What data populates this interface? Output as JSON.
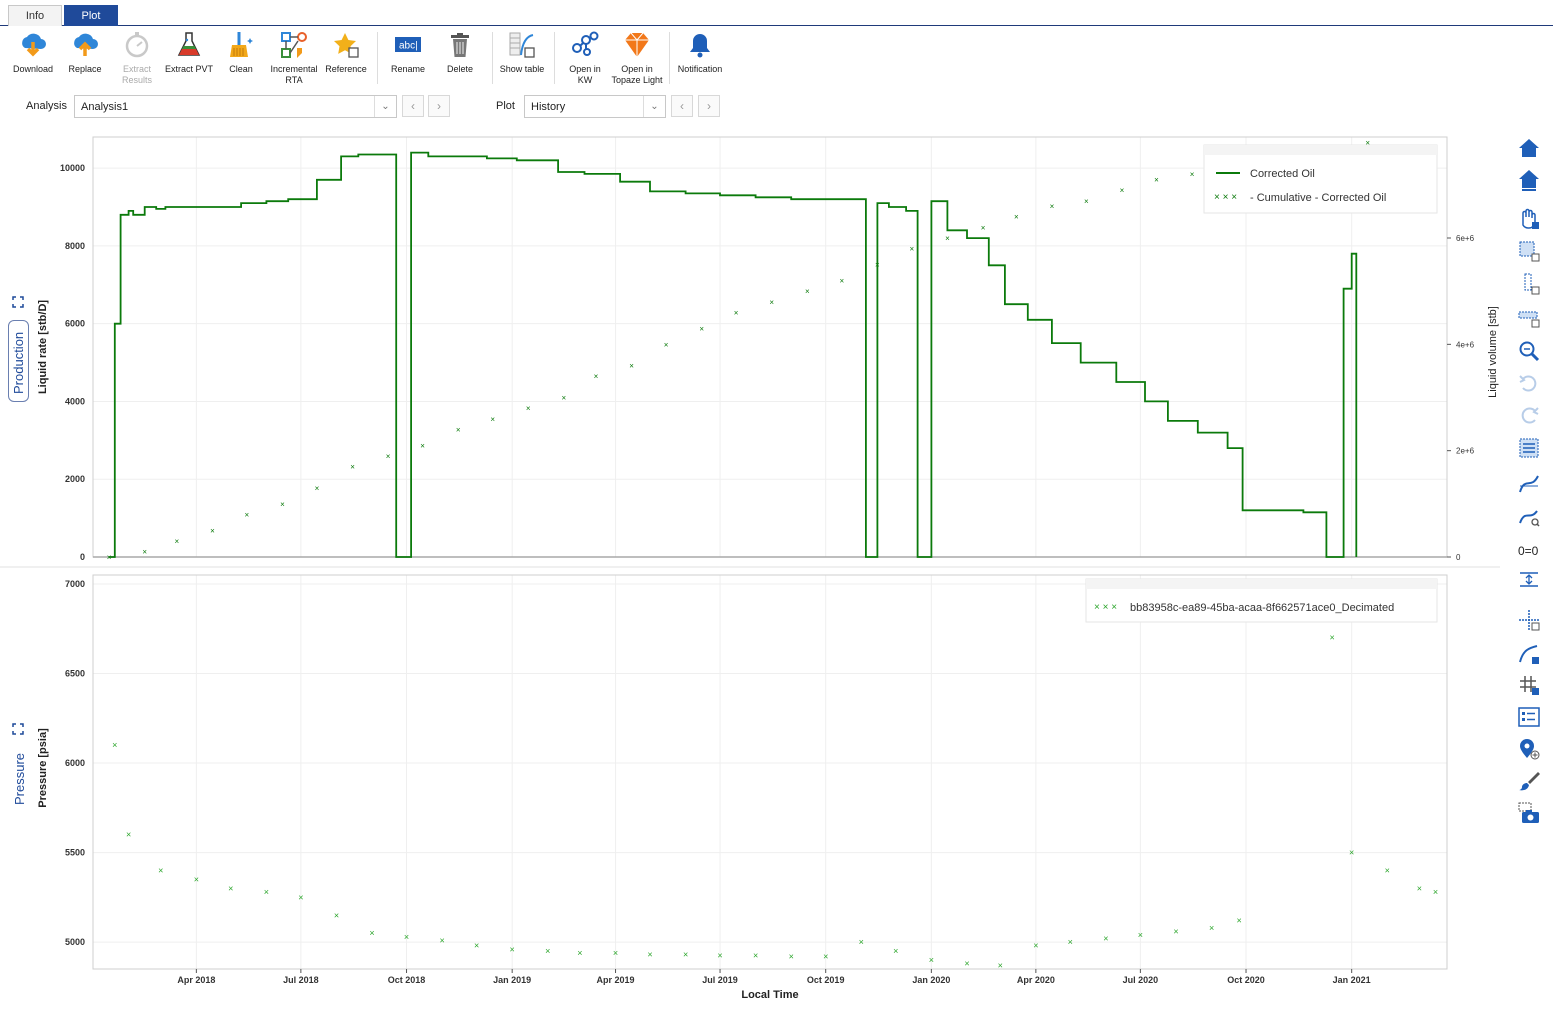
{
  "tabs": [
    {
      "label": "Info",
      "active": false
    },
    {
      "label": "Plot",
      "active": true
    }
  ],
  "toolbar": {
    "download": "Download",
    "replace": "Replace",
    "extract_results": "Extract\nResults",
    "extract_pvt": "Extract PVT",
    "clean": "Clean",
    "incremental_rta": "Incremental\nRTA",
    "reference": "Reference",
    "rename": "Rename",
    "delete": "Delete",
    "show_table": "Show table",
    "open_kw": "Open in\nKW",
    "open_topaze": "Open in\nTopaze Light",
    "notification": "Notification"
  },
  "selectors": {
    "analysis_label": "Analysis",
    "analysis_value": "Analysis1",
    "plot_label": "Plot",
    "plot_value": "History"
  },
  "side_labels": {
    "production": "Production",
    "pressure": "Pressure"
  },
  "colors": {
    "accent": "#1f4a9a",
    "oil": "#0b7a0b",
    "pressure": "#2aa52a"
  },
  "chart_data": [
    {
      "type": "line",
      "ylabel": "Liquid rate [stb/D]",
      "y2label": "Liquid volume [stb]",
      "ylim": [
        0,
        10800
      ],
      "y2lim": [
        0,
        7900000
      ],
      "yticks": [
        "0",
        "2000",
        "4000",
        "6000",
        "8000",
        "10000"
      ],
      "y2ticks": [
        "0",
        "2e+6",
        "4e+6",
        "6e+6"
      ],
      "legend_position": "top-right",
      "series": [
        {
          "name": "Corrected Oil",
          "style": "step-line",
          "x": [
            "2018-01-15",
            "2018-01-20",
            "2018-01-25",
            "2018-02-01",
            "2018-02-05",
            "2018-02-15",
            "2018-02-25",
            "2018-03-05",
            "2018-03-20",
            "2018-04-05",
            "2018-04-20",
            "2018-05-10",
            "2018-06-01",
            "2018-06-20",
            "2018-07-15",
            "2018-08-05",
            "2018-08-20",
            "2018-09-10",
            "2018-09-22",
            "2018-10-05",
            "2018-10-20",
            "2018-11-10",
            "2018-12-10",
            "2019-01-05",
            "2019-02-10",
            "2019-03-05",
            "2019-04-05",
            "2019-05-01",
            "2019-06-01",
            "2019-07-01",
            "2019-08-01",
            "2019-09-01",
            "2019-10-01",
            "2019-10-20",
            "2019-11-05",
            "2019-11-15",
            "2019-11-25",
            "2019-12-10",
            "2019-12-20",
            "2020-01-01",
            "2020-01-15",
            "2020-02-01",
            "2020-02-20",
            "2020-03-05",
            "2020-03-25",
            "2020-04-15",
            "2020-05-10",
            "2020-06-10",
            "2020-07-05",
            "2020-07-25",
            "2020-08-20",
            "2020-09-15",
            "2020-09-28",
            "2020-11-20",
            "2020-12-10",
            "2020-12-25",
            "2021-01-01",
            "2021-01-05"
          ],
          "values": [
            0,
            6000,
            8800,
            8900,
            8800,
            9000,
            8950,
            9000,
            9000,
            9000,
            9000,
            9100,
            9150,
            9200,
            9700,
            10300,
            10350,
            10350,
            0,
            10400,
            10300,
            10300,
            10250,
            10200,
            9900,
            9850,
            9650,
            9400,
            9350,
            9300,
            9250,
            9200,
            9200,
            9200,
            0,
            9100,
            9000,
            8900,
            0,
            9150,
            8400,
            8200,
            7500,
            6500,
            6100,
            5500,
            5000,
            4500,
            4000,
            3500,
            3200,
            2800,
            1200,
            1150,
            0,
            6900,
            7800,
            0
          ]
        },
        {
          "name": "- Cumulative - Corrected Oil",
          "style": "markers",
          "axis": "y2",
          "x": [
            "2018-01-15",
            "2018-02-15",
            "2018-03-15",
            "2018-04-15",
            "2018-05-15",
            "2018-06-15",
            "2018-07-15",
            "2018-08-15",
            "2018-09-15",
            "2018-10-15",
            "2018-11-15",
            "2018-12-15",
            "2019-01-15",
            "2019-02-15",
            "2019-03-15",
            "2019-04-15",
            "2019-05-15",
            "2019-06-15",
            "2019-07-15",
            "2019-08-15",
            "2019-09-15",
            "2019-10-15",
            "2019-11-15",
            "2019-12-15",
            "2020-01-15",
            "2020-02-15",
            "2020-03-15",
            "2020-04-15",
            "2020-05-15",
            "2020-06-15",
            "2020-07-15",
            "2020-08-15",
            "2020-09-15",
            "2020-10-15",
            "2020-11-15",
            "2020-12-15",
            "2021-01-15"
          ],
          "values": [
            0,
            100000,
            300000,
            500000,
            800000,
            1000000,
            1300000,
            1700000,
            1900000,
            2100000,
            2400000,
            2600000,
            2800000,
            3000000,
            3400000,
            3600000,
            4000000,
            4300000,
            4600000,
            4800000,
            5000000,
            5200000,
            5500000,
            5800000,
            6000000,
            6200000,
            6400000,
            6600000,
            6700000,
            6900000,
            7100000,
            7200000,
            7300000,
            7400000,
            7500000,
            7600000,
            7800000
          ]
        }
      ]
    },
    {
      "type": "scatter",
      "title": "",
      "xlabel": "Local Time",
      "ylabel": "Pressure [psia]",
      "ylim": [
        4850,
        7050
      ],
      "yticks": [
        "5000",
        "5500",
        "6000",
        "6500",
        "7000"
      ],
      "xticks": [
        "Apr 2018",
        "Jul 2018",
        "Oct 2018",
        "Jan 2019",
        "Apr 2019",
        "Jul 2019",
        "Oct 2019",
        "Jan 2020",
        "Apr 2020",
        "Jul 2020",
        "Oct 2020",
        "Jan 2021"
      ],
      "legend_position": "top-right",
      "series": [
        {
          "name": "bb83958c-ea89-45ba-acaa-8f662571ace0_Decimated",
          "x": [
            "2018-01-20",
            "2018-02-01",
            "2018-03-01",
            "2018-04-01",
            "2018-05-01",
            "2018-06-01",
            "2018-07-01",
            "2018-08-01",
            "2018-09-01",
            "2018-10-01",
            "2018-11-01",
            "2018-12-01",
            "2019-01-01",
            "2019-02-01",
            "2019-03-01",
            "2019-04-01",
            "2019-05-01",
            "2019-06-01",
            "2019-07-01",
            "2019-08-01",
            "2019-09-01",
            "2019-10-01",
            "2019-11-01",
            "2019-12-01",
            "2020-01-01",
            "2020-02-01",
            "2020-03-01",
            "2020-04-01",
            "2020-05-01",
            "2020-06-01",
            "2020-07-01",
            "2020-08-01",
            "2020-09-01",
            "2020-09-25",
            "2020-12-15",
            "2021-01-01",
            "2021-02-01",
            "2021-03-01",
            "2021-03-15"
          ],
          "values": [
            6100,
            5600,
            5400,
            5350,
            5300,
            5280,
            5250,
            5150,
            5050,
            5030,
            5010,
            4980,
            4960,
            4950,
            4940,
            4940,
            4930,
            4930,
            4925,
            4925,
            4920,
            4920,
            5000,
            4950,
            4900,
            4880,
            4870,
            4980,
            5000,
            5020,
            5040,
            5060,
            5080,
            5120,
            6700,
            5500,
            5400,
            5300,
            5280
          ]
        }
      ]
    }
  ]
}
